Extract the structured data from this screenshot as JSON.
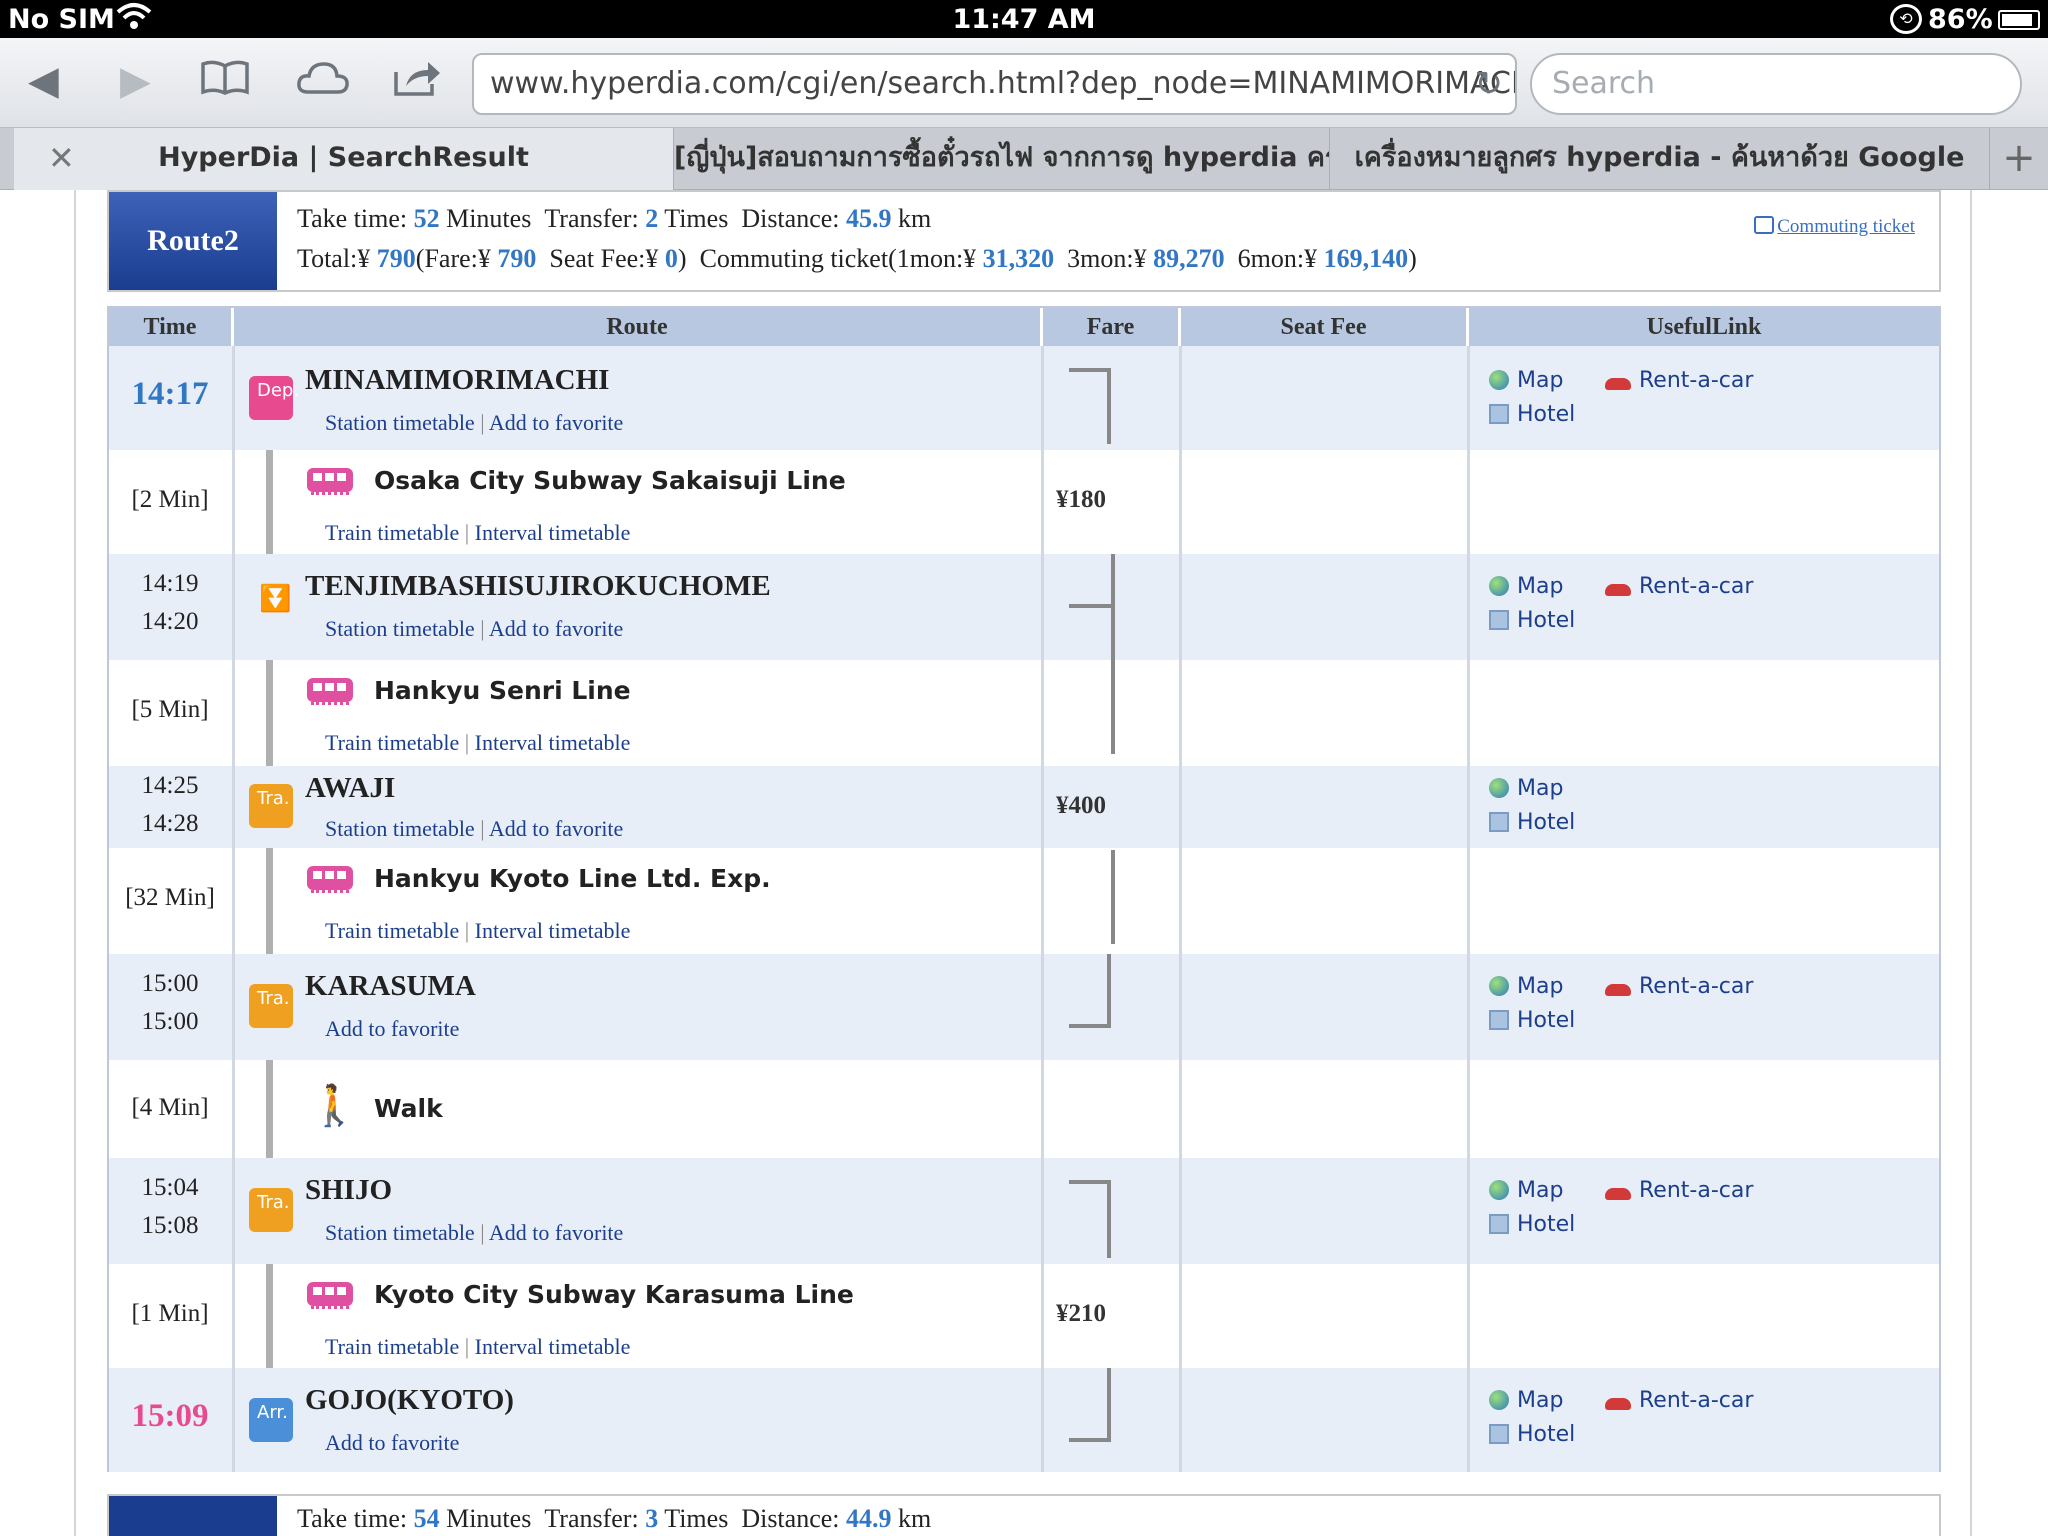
{
  "status_bar": {
    "carrier": "No SIM",
    "time": "11:47 AM",
    "battery": "86%"
  },
  "browser": {
    "url": "www.hyperdia.com/cgi/en/search.html?dep_node=MINAMIMORIMACHI",
    "search_placeholder": "Search",
    "tabs": [
      {
        "title": "HyperDia | SearchResult"
      },
      {
        "title": "[ญี่ปุ่น]สอบถามการซื้อตั๋วรถไฟ จากการดู hyperdia ครับ -..."
      },
      {
        "title": "เครื่องหมายลูกศร hyperdia - ค้นหาด้วย Google"
      }
    ]
  },
  "route2": {
    "badge": "Route2",
    "take_time_label": "Take time:",
    "take_time": "52",
    "minutes_label": "Minutes",
    "transfer_label": "Transfer:",
    "transfer": "2",
    "times_label": "Times",
    "distance_label": "Distance:",
    "distance": "45.9",
    "km_label": "km",
    "total_label": "Total:¥",
    "total": "790",
    "fare_label": "(Fare:¥",
    "fare": "790",
    "seat_label": "Seat Fee:¥",
    "seat": "0",
    "close_paren": ")",
    "commuting_label": "Commuting ticket(1mon:¥",
    "mon1": "31,320",
    "mon3_label": "3mon:¥",
    "mon3": "89,270",
    "mon6_label": "6mon:¥",
    "mon6": "169,140",
    "commuting_link": "Commuting ticket"
  },
  "table": {
    "headers": {
      "time": "Time",
      "route": "Route",
      "fare": "Fare",
      "seat_fee": "Seat Fee",
      "useful_link": "UsefulLink"
    },
    "links": {
      "station_timetable": "Station timetable",
      "add_favorite": "Add to favorite",
      "train_timetable": "Train timetable",
      "interval_timetable": "Interval timetable",
      "sep": "|",
      "map": "Map",
      "hotel": "Hotel",
      "rent": "Rent-a-car"
    },
    "stations": [
      {
        "name": "MINAMIMORIMACHI",
        "time1": "14:17",
        "icon": "Dep."
      },
      {
        "name": "TENJIMBASHISUJIROKUCHOME",
        "time1": "14:19",
        "time2": "14:20"
      },
      {
        "name": "AWAJI",
        "time1": "14:25",
        "time2": "14:28",
        "icon": "Tra."
      },
      {
        "name": "KARASUMA",
        "time1": "15:00",
        "time2": "15:00",
        "icon": "Tra."
      },
      {
        "name": "SHIJO",
        "time1": "15:04",
        "time2": "15:08",
        "icon": "Tra."
      },
      {
        "name": "GOJO(KYOTO)",
        "time1": "15:09",
        "icon": "Arr."
      }
    ],
    "legs": [
      {
        "line": "Osaka City Subway Sakaisuji Line",
        "duration": "[2 Min]",
        "fare": "¥180"
      },
      {
        "line": "Hankyu Senri Line",
        "duration": "[5 Min]"
      },
      {
        "line": "Hankyu Kyoto Line Ltd. Exp.",
        "duration": "[32 Min]"
      },
      {
        "line": "Walk",
        "duration": "[4 Min]"
      },
      {
        "line": "Kyoto City Subway Karasuma Line",
        "duration": "[1 Min]",
        "fare": "¥210"
      }
    ],
    "fare_awaji": "¥400"
  },
  "route3": {
    "take_time_label": "Take time:",
    "take_time": "54",
    "minutes_label": "Minutes",
    "transfer_label": "Transfer:",
    "transfer": "3",
    "times_label": "Times",
    "distance_label": "Distance:",
    "distance": "44.9",
    "km_label": "km"
  },
  "colors": {
    "accent_blue": "#3277c4",
    "dep_time": "#3277c4",
    "arr_time": "#e84a90",
    "header_bg": "#b8c8e0",
    "station_row_bg": "#e8eef8"
  }
}
